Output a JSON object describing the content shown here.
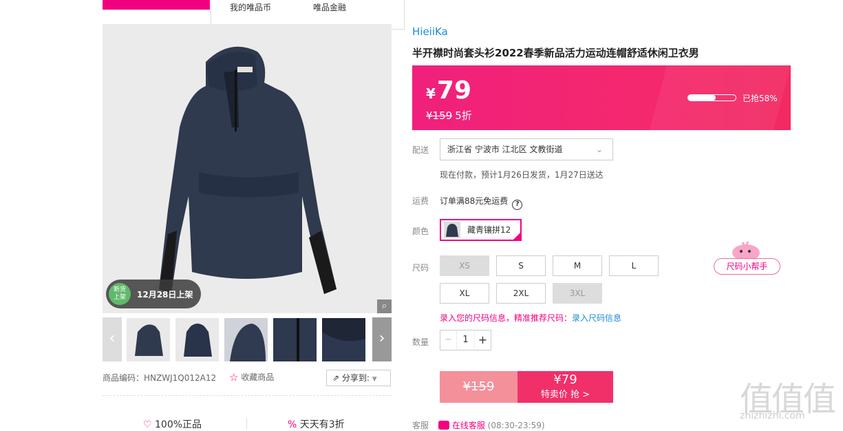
{
  "header": {
    "dropdown_item1": "我的唯品币",
    "dropdown_item2": "唯品金融"
  },
  "gallery": {
    "badge_circle": "新货\n上架",
    "badge_text": "12月28日上架",
    "zoom_icon": "magnifier-icon",
    "product_code_label": "商品编码：",
    "product_code": "HNZWJ1Q012A12",
    "favorite": "收藏商品",
    "share": "分享到:",
    "trust1": "100%正品",
    "trust2": "天天有3折"
  },
  "product": {
    "brand": "HieiiKa",
    "title": "半开襟时尚套头衫2022春季新品活力运动连帽舒适休闲卫衣男",
    "price_symbol": "¥",
    "price": "79",
    "original_price": "¥159",
    "discount": "5折",
    "sold_label": "已抢58%",
    "sold_fraction": 0.58
  },
  "delivery": {
    "label": "配送",
    "address": "浙江省 宁波市 江北区 文教街道",
    "note": "现在付款，预计1月26日发货，1月27日送达"
  },
  "shipping": {
    "label": "运费",
    "text": "订单满88元免运费"
  },
  "color": {
    "label": "颜色",
    "selected": "藏青镶拼12"
  },
  "size": {
    "label": "尺码",
    "options": [
      {
        "name": "XS",
        "disabled": true
      },
      {
        "name": "S",
        "disabled": false
      },
      {
        "name": "M",
        "disabled": false
      },
      {
        "name": "L",
        "disabled": false
      },
      {
        "name": "XL",
        "disabled": false
      },
      {
        "name": "2XL",
        "disabled": false
      },
      {
        "name": "3XL",
        "disabled": true
      }
    ],
    "hint": "录入您的尺码信息，精准推荐尺码：",
    "hint_link": "录入尺码信息",
    "helper": "尺码小帮手"
  },
  "quantity": {
    "label": "数量",
    "minus": "−",
    "value": "1",
    "plus": "+"
  },
  "buy": {
    "original": "¥159",
    "price": "¥79",
    "cta": "特卖价 抢 >"
  },
  "service": {
    "label": "客服",
    "online": "在线客服",
    "hours": "(08:30-23:59)"
  },
  "watermark": {
    "main": "值值值",
    "url": "zhizhizhi.com"
  },
  "colors": {
    "accent": "#f10180",
    "price_bg": "#f4286e",
    "link": "#1c8bd4"
  }
}
